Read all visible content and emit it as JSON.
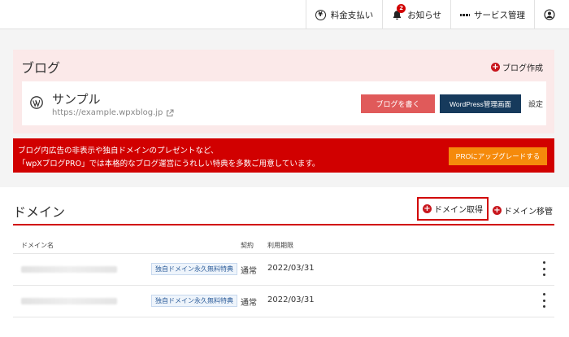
{
  "topbar": {
    "billing_label": "料金支払い",
    "notifications_label": "お知らせ",
    "notifications_count": "2",
    "services_label": "サービス管理",
    "icons": [
      "yen-icon",
      "bell-icon",
      "grid-icon",
      "user-icon"
    ]
  },
  "blog": {
    "section_title": "ブログ",
    "create_label": "ブログ作成",
    "site_name": "サンプル",
    "site_url": "https://example.wpxblog.jp",
    "write_button": "ブログを書く",
    "wp_admin_button": "WordPress管理画面",
    "settings_label": "設定"
  },
  "promo": {
    "line1": "ブログ内広告の非表示や独自ドメインのプレゼントなど、",
    "line2": "「wpXブログPRO」では本格的なブログ運営にうれしい特典を多数ご用意しています。",
    "upgrade_button": "PROにアップグレードする"
  },
  "domain": {
    "section_title": "ドメイン",
    "acquire_label": "ドメイン取得",
    "transfer_label": "ドメイン移管",
    "columns": {
      "name": "ドメイン名",
      "contract": "契約",
      "expiry": "利用期限"
    },
    "rows": [
      {
        "tag": "独自ドメイン永久無料特典",
        "contract": "通常",
        "expiry": "2022/03/31"
      },
      {
        "tag": "独自ドメイン永久無料特典",
        "contract": "通常",
        "expiry": "2022/03/31"
      }
    ]
  },
  "colors": {
    "accent_red": "#d10000",
    "write_button": "#e05a5a",
    "wp_button": "#163a5c",
    "upgrade_button": "#f58a0b",
    "blog_section_bg": "#fbe9e9"
  }
}
